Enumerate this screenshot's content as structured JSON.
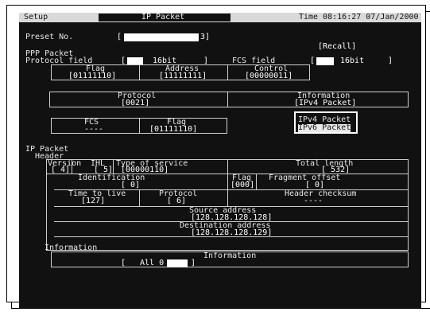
{
  "titlebar": {
    "left": "Setup",
    "center": "IP Packet",
    "right": "Time 08:16:27 07/Jan/2000"
  },
  "preset": {
    "label": "Preset No.",
    "open": "[",
    "value": "3]"
  },
  "recall_label": "[Recall]",
  "ppp": {
    "section": "PPP Packet",
    "protocol_field_label": "Protocol field",
    "protocol_field_open": "[",
    "protocol_field_value": "16bit",
    "protocol_field_close": "]",
    "fcs_field_label": "FCS field",
    "fcs_field_open": "[",
    "fcs_field_value": "16bit",
    "fcs_field_close": "]",
    "flag_label": "Flag",
    "flag_value": "[01111110]",
    "address_label": "Address",
    "address_value": "[11111111]",
    "control_label": "Control",
    "control_value": "[00000011]",
    "protocol_label": "Protocol",
    "protocol_value": "[0021]",
    "information_label": "Information",
    "information_value": "[IPv4 Packet]",
    "fcs_label": "FCS",
    "fcs_value": "----",
    "flag2_label": "Flag",
    "flag2_value": "[01111110]"
  },
  "info_popup": {
    "options": [
      "IPv4 Packet",
      "IPv6 Packet"
    ],
    "selected": "IPv6 Packet"
  },
  "ip": {
    "section": "IP Packet",
    "header_label": "Header",
    "version_label": "Version",
    "version_value": "[ 4]",
    "ihl_label": "IHL",
    "ihl_value": "[ 5]",
    "tos_label": "Type of service",
    "tos_value": "[00000110]",
    "total_length_label": "Total length",
    "total_length_value": "[ 532]",
    "identification_label": "Identification",
    "identification_value": "[ 0]",
    "flag_label": "Flag",
    "flag_value": "[000]",
    "fragment_offset_label": "Fragment offset",
    "fragment_offset_value": "[ 0]",
    "ttl_label": "Time to live",
    "ttl_value": "[127]",
    "protocol_label": "Protocol",
    "protocol_value": "[ 6]",
    "header_checksum_label": "Header checksum",
    "header_checksum_value": "----",
    "source_label": "Source address",
    "source_value": "[128.128.128.128]",
    "dest_label": "Destination address",
    "dest_value": "[128.128.128.129]"
  },
  "information": {
    "section": "Information",
    "box_label": "Information",
    "open": "[",
    "value": "All 0",
    "close": "]"
  }
}
